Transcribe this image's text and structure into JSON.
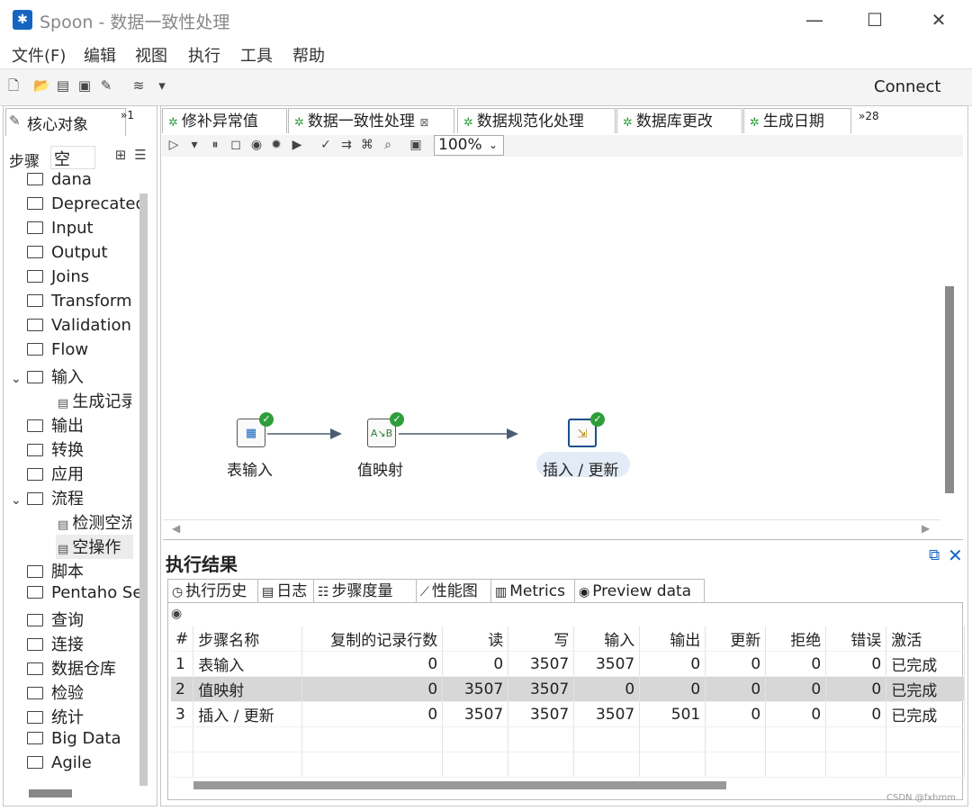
{
  "window": {
    "title": "Spoon - 数据一致性处理",
    "minimize_glyph": "—",
    "maximize_glyph": "☐",
    "close_glyph": "✕"
  },
  "menu": [
    "文件(F)",
    "编辑",
    "视图",
    "执行",
    "工具",
    "帮助"
  ],
  "toolbar": {
    "connect_label": "Connect",
    "icons": [
      "new-file-icon",
      "open-icon",
      "explore-icon",
      "save-icon",
      "save-as-icon",
      "layers-icon",
      "dropdown-icon"
    ]
  },
  "left_panel": {
    "tab_label": "核心对象",
    "more_label": "»1",
    "step_label": "步骤",
    "search_value": "空",
    "tree": [
      {
        "label": "dana",
        "type": "folder"
      },
      {
        "label": "Deprecated",
        "type": "folder"
      },
      {
        "label": "Input",
        "type": "folder"
      },
      {
        "label": "Output",
        "type": "folder"
      },
      {
        "label": "Joins",
        "type": "folder"
      },
      {
        "label": "Transform",
        "type": "folder"
      },
      {
        "label": "Validation",
        "type": "folder"
      },
      {
        "label": "Flow",
        "type": "folder"
      },
      {
        "label": "输入",
        "type": "folder",
        "expanded": true
      },
      {
        "label": "生成记录",
        "type": "child"
      },
      {
        "label": "输出",
        "type": "folder"
      },
      {
        "label": "转换",
        "type": "folder"
      },
      {
        "label": "应用",
        "type": "folder"
      },
      {
        "label": "流程",
        "type": "folder",
        "expanded": true
      },
      {
        "label": "检测空流",
        "type": "child"
      },
      {
        "label": "空操作",
        "type": "child",
        "selected": true
      },
      {
        "label": "脚本",
        "type": "folder"
      },
      {
        "label": "Pentaho Server",
        "type": "folder"
      },
      {
        "label": "查询",
        "type": "folder"
      },
      {
        "label": "连接",
        "type": "folder"
      },
      {
        "label": "数据仓库",
        "type": "folder"
      },
      {
        "label": "检验",
        "type": "folder"
      },
      {
        "label": "统计",
        "type": "folder"
      },
      {
        "label": "Big Data",
        "type": "folder"
      },
      {
        "label": "Agile",
        "type": "folder"
      }
    ]
  },
  "editor_tabs": [
    {
      "label": "修补异常值",
      "active": false
    },
    {
      "label": "数据一致性处理",
      "active": true,
      "close": "⊠"
    },
    {
      "label": "数据规范化处理",
      "active": false
    },
    {
      "label": "数据库更改",
      "active": false
    },
    {
      "label": "生成日期",
      "active": false
    }
  ],
  "editor_tabs_more": "»28",
  "zoom": "100%",
  "canvas": {
    "steps": [
      {
        "label": "表输入",
        "icon": "table-input-icon",
        "glyph": "▦"
      },
      {
        "label": "值映射",
        "icon": "value-mapper-icon",
        "glyph": "A↘B"
      },
      {
        "label": "插入 / 更新",
        "icon": "insert-update-icon",
        "glyph": "⇲"
      }
    ]
  },
  "results": {
    "title": "执行结果",
    "tabs": [
      {
        "label": "执行历史",
        "icon": "history-icon",
        "glyph": "◷"
      },
      {
        "label": "日志",
        "icon": "log-icon",
        "glyph": "▤"
      },
      {
        "label": "步骤度量",
        "icon": "step-metrics-icon",
        "glyph": "☷",
        "active": true
      },
      {
        "label": "性能图",
        "icon": "chart-icon",
        "glyph": "⟋"
      },
      {
        "label": "Metrics",
        "icon": "metrics-icon",
        "glyph": "▥"
      },
      {
        "label": "Preview data",
        "icon": "eye-icon",
        "glyph": "◉"
      }
    ],
    "columns": [
      "#",
      "步骤名称",
      "复制的记录行数",
      "读",
      "写",
      "输入",
      "输出",
      "更新",
      "拒绝",
      "错误",
      "激活"
    ],
    "rows": [
      [
        "1",
        "表输入",
        "0",
        "0",
        "3507",
        "3507",
        "0",
        "0",
        "0",
        "0",
        "已完成"
      ],
      [
        "2",
        "值映射",
        "0",
        "3507",
        "3507",
        "0",
        "0",
        "0",
        "0",
        "0",
        "已完成"
      ],
      [
        "3",
        "插入 / 更新",
        "0",
        "3507",
        "3507",
        "3507",
        "501",
        "0",
        "0",
        "0",
        "已完成"
      ]
    ]
  },
  "watermark": "CSDN @fxhmm"
}
